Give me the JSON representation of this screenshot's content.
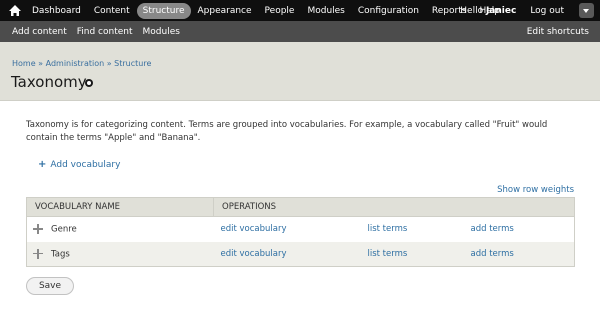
{
  "toolbar": {
    "home_icon": "home-icon",
    "menu": [
      {
        "label": "Dashboard",
        "active": false
      },
      {
        "label": "Content",
        "active": false
      },
      {
        "label": "Structure",
        "active": true
      },
      {
        "label": "Appearance",
        "active": false
      },
      {
        "label": "People",
        "active": false
      },
      {
        "label": "Modules",
        "active": false
      },
      {
        "label": "Configuration",
        "active": false
      },
      {
        "label": "Reports",
        "active": false
      },
      {
        "label": "Help",
        "active": false
      }
    ],
    "hello_prefix": "Hello ",
    "username": "Janiec",
    "logout": "Log out",
    "toggle_icon": "chevron-down-icon"
  },
  "shortcuts": {
    "items": [
      "Add content",
      "Find content",
      "Modules"
    ],
    "edit": "Edit shortcuts"
  },
  "breadcrumb": {
    "items": [
      "Home",
      "Administration",
      "Structure"
    ],
    "separator": "»"
  },
  "page": {
    "title": "Taxonomy",
    "description": "Taxonomy is for categorizing content. Terms are grouped into vocabularies. For example, a vocabulary called \"Fruit\" would contain the terms \"Apple\" and \"Banana\".",
    "add_vocabulary": "Add vocabulary",
    "show_row_weights": "Show row weights",
    "save": "Save"
  },
  "table": {
    "headers": [
      "Vocabulary name",
      "Operations"
    ],
    "rows": [
      {
        "name": "Genre",
        "edit": "edit vocabulary",
        "list": "list terms",
        "add": "add terms"
      },
      {
        "name": "Tags",
        "edit": "edit vocabulary",
        "list": "list terms",
        "add": "add terms"
      }
    ]
  },
  "colors": {
    "toolbar_bg": "#0f0f0f",
    "shortcuts_bg": "#4c4c4c",
    "header_bg": "#e0e0d8",
    "link": "#2e6fa3",
    "active_tab": "#888888"
  }
}
